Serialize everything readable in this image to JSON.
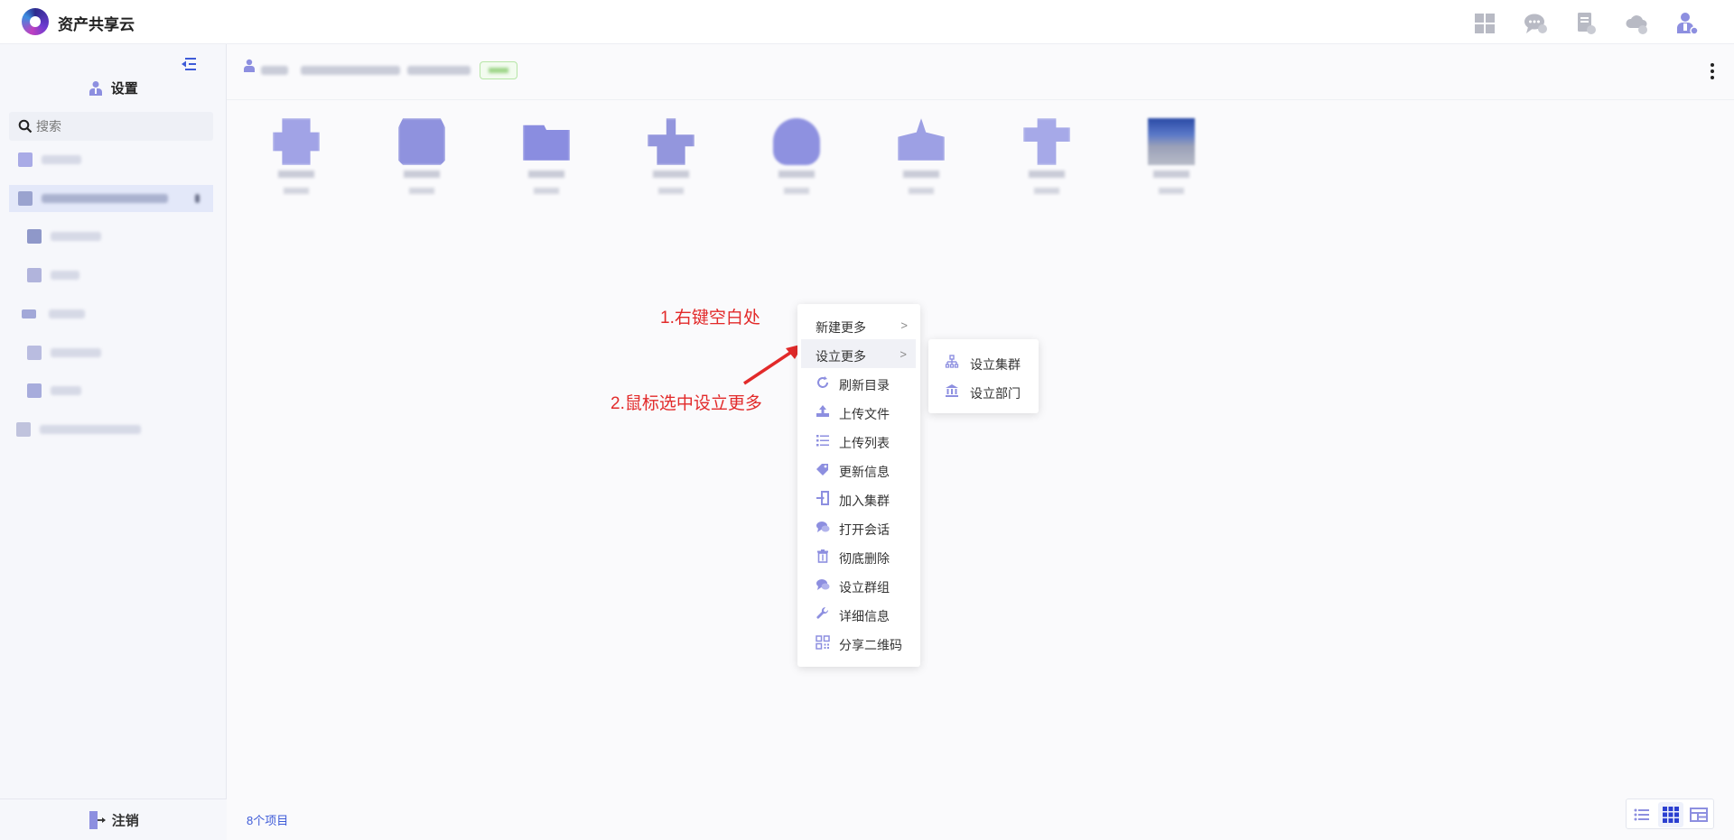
{
  "app": {
    "title": "资产共享云"
  },
  "top_icons": [
    "dashboard-icon",
    "chat-icon",
    "document-icon",
    "cloud-icon",
    "user-settings-icon"
  ],
  "sidebar": {
    "title": "设置",
    "search_placeholder": "搜索",
    "logout_label": "注销"
  },
  "main": {
    "item_count": "8个项目"
  },
  "annotations": {
    "step1": "1.右键空白处",
    "step2": "2.鼠标选中设立更多"
  },
  "context_menu": {
    "items": [
      {
        "label": "新建更多",
        "icon": "",
        "has_submenu": true
      },
      {
        "label": "设立更多",
        "icon": "",
        "has_submenu": true
      },
      {
        "label": "刷新目录",
        "icon": "refresh-icon"
      },
      {
        "label": "上传文件",
        "icon": "upload-icon"
      },
      {
        "label": "上传列表",
        "icon": "list-icon"
      },
      {
        "label": "更新信息",
        "icon": "tag-icon"
      },
      {
        "label": "加入集群",
        "icon": "join-icon"
      },
      {
        "label": "打开会话",
        "icon": "chat-icon"
      },
      {
        "label": "彻底删除",
        "icon": "trash-icon"
      },
      {
        "label": "设立群组",
        "icon": "group-chat-icon"
      },
      {
        "label": "详细信息",
        "icon": "wrench-icon"
      },
      {
        "label": "分享二维码",
        "icon": "qrcode-icon"
      }
    ],
    "arrow": ">"
  },
  "sub_menu": {
    "items": [
      {
        "label": "设立集群",
        "icon": "org-tree-icon"
      },
      {
        "label": "设立部门",
        "icon": "bank-icon"
      }
    ]
  },
  "colors": {
    "accent": "#3e5bd8",
    "icon_purple": "#8d8fe0",
    "annotation_red": "#e22a2a"
  }
}
